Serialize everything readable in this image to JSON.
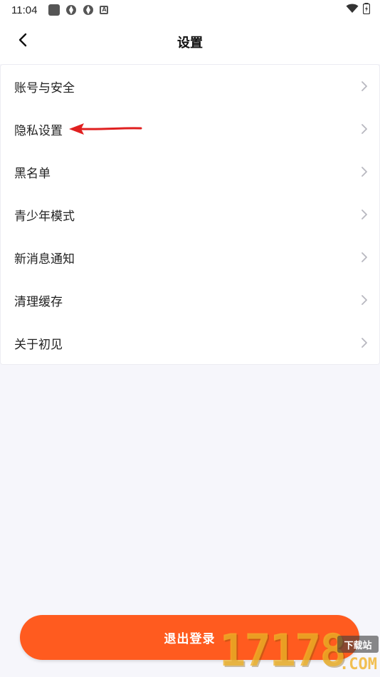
{
  "status_bar": {
    "time": "11:04",
    "left_icons": [
      "square-app-icon",
      "aperture-icon",
      "aperture-icon",
      "a-badge-icon"
    ],
    "right_icons": [
      "wifi-icon",
      "battery-charging-icon"
    ]
  },
  "header": {
    "title": "设置",
    "back_icon": "chevron-left-icon"
  },
  "settings": {
    "items": [
      {
        "label": "账号与安全"
      },
      {
        "label": "隐私设置"
      },
      {
        "label": "黑名单"
      },
      {
        "label": "青少年模式"
      },
      {
        "label": "新消息通知"
      },
      {
        "label": "清理缓存"
      },
      {
        "label": "关于初见"
      }
    ],
    "chevron_icon": "chevron-right-icon"
  },
  "annotation": {
    "arrow_color": "#e02020",
    "points_to": "隐私设置"
  },
  "logout": {
    "label": "退出登录",
    "color": "#ff5b1f"
  },
  "watermark": {
    "digits": "17178",
    "badge": "下载站",
    "suffix": ".COM"
  },
  "colors": {
    "background": "#f6f6fb",
    "surface": "#ffffff",
    "accent": "#ff5b1f"
  }
}
